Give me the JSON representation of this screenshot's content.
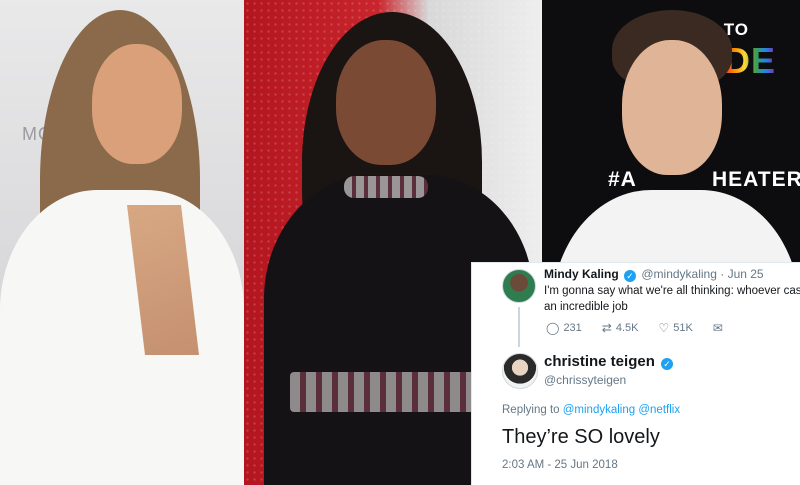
{
  "photos": {
    "left": {
      "backdrop_text": "MO"
    },
    "middle": {},
    "right": {
      "backdrop_top": "TH    SH TO",
      "backdrop_pride": "DE",
      "backdrop_hash": "#A",
      "backdrop_heater": "HEATER"
    }
  },
  "tweet1": {
    "name": "Mindy Kaling",
    "handle": "@mindykaling",
    "date": "· Jun 25",
    "text_line1": "I'm gonna say what we're all thinking: whoever cast th",
    "text_line2": "an incredible job",
    "replies": "231",
    "retweets": "4.5K",
    "likes": "51K"
  },
  "tweet2": {
    "name": "christine teigen",
    "handle": "@chrissyteigen",
    "replying_prefix": "Replying to",
    "mention1": "@mindykaling",
    "mention2": "@netflix",
    "text": "They’re SO lovely",
    "timestamp": "2:03 AM - 25 Jun 2018"
  },
  "icons": {
    "verified": "verified-badge-icon",
    "reply": "reply-icon",
    "retweet": "retweet-icon",
    "like": "heart-icon",
    "dm": "envelope-icon"
  },
  "colors": {
    "twitter_blue": "#1da1f2",
    "text_dark": "#14171a",
    "text_muted": "#657786"
  }
}
